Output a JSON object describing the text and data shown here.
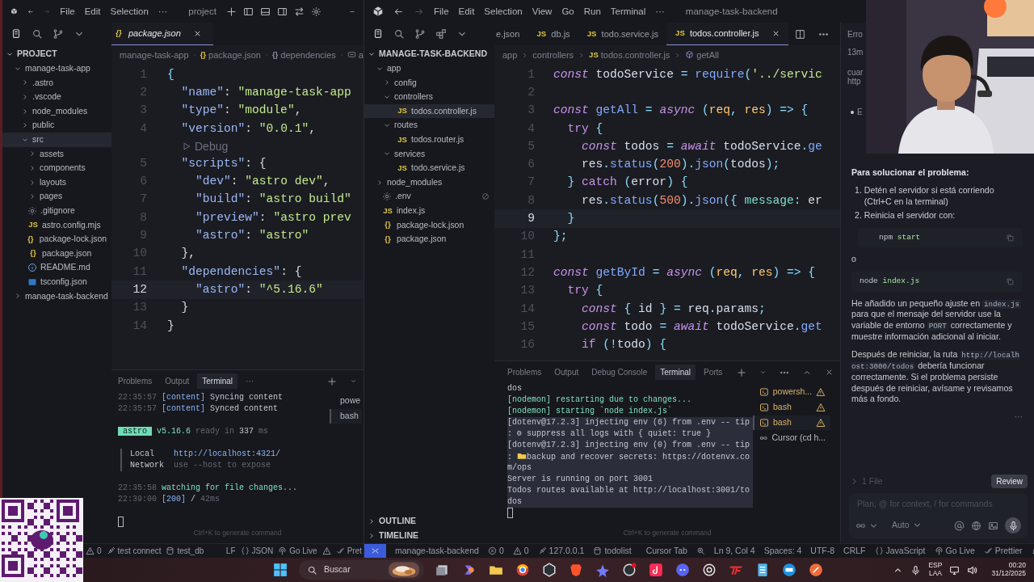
{
  "left_window": {
    "title": "project",
    "menus": [
      "File",
      "Edit",
      "Selection",
      "···"
    ],
    "explorer": {
      "header": "PROJECT",
      "expanded": true,
      "tree": [
        {
          "label": "manage-task-app",
          "kind": "folder",
          "expanded": true,
          "selected": false,
          "children": [
            {
              "label": ".astro",
              "kind": "folder",
              "expanded": false,
              "selected": false
            },
            {
              "label": ".vscode",
              "kind": "folder",
              "expanded": false,
              "selected": false
            },
            {
              "label": "node_modules",
              "kind": "folder",
              "expanded": false,
              "selected": false
            },
            {
              "label": "public",
              "kind": "folder",
              "expanded": false,
              "selected": false
            },
            {
              "label": "src",
              "kind": "folder",
              "expanded": true,
              "selected": true,
              "children": [
                {
                  "label": "assets",
                  "kind": "folder",
                  "expanded": false,
                  "selected": false
                },
                {
                  "label": "components",
                  "kind": "folder",
                  "expanded": false,
                  "selected": false
                },
                {
                  "label": "layouts",
                  "kind": "folder",
                  "expanded": false,
                  "selected": false
                },
                {
                  "label": "pages",
                  "kind": "folder",
                  "expanded": false,
                  "selected": false
                }
              ]
            },
            {
              "label": ".gitignore",
              "kind": "git",
              "selected": false
            },
            {
              "label": "astro.config.mjs",
              "kind": "js",
              "glyph": "JS",
              "selected": false
            },
            {
              "label": "package-lock.json",
              "kind": "json",
              "glyph": "{}",
              "selected": false
            },
            {
              "label": "package.json",
              "kind": "json",
              "glyph": "{}",
              "selected": false
            },
            {
              "label": "README.md",
              "kind": "readme",
              "selected": false
            },
            {
              "label": "tsconfig.json",
              "kind": "ts",
              "selected": false
            }
          ]
        },
        {
          "label": "manage-task-backend",
          "kind": "folder",
          "expanded": false,
          "selected": false
        }
      ]
    },
    "tabs": [
      {
        "glyph": "{}",
        "label": "package.json",
        "selected": true,
        "preview": true
      }
    ],
    "breadcrumb": [
      {
        "kind": "folder",
        "text": "manage-task-app"
      },
      {
        "kind": "file",
        "glyph": "{}",
        "text": "package.json"
      },
      {
        "kind": "symbol",
        "glyph": "{}",
        "text": "dependencies"
      },
      {
        "kind": "field",
        "text": "a"
      }
    ],
    "code": [
      {
        "kind": "code",
        "number": "1",
        "current": false,
        "tokens": [
          {
            "text": "{",
            "kind": "punct"
          }
        ]
      },
      {
        "kind": "code",
        "number": "2",
        "current": false,
        "tokens": [
          {
            "text": "  \"name\"",
            "kind": "key"
          },
          {
            "text": ": ",
            "kind": "plain"
          },
          {
            "text": "\"manage-task-app",
            "kind": "str"
          }
        ]
      },
      {
        "kind": "code",
        "number": "3",
        "current": false,
        "tokens": [
          {
            "text": "  \"type\"",
            "kind": "key"
          },
          {
            "text": ": ",
            "kind": "plain"
          },
          {
            "text": "\"module\"",
            "kind": "str"
          },
          {
            "text": ",",
            "kind": "plain"
          }
        ]
      },
      {
        "kind": "code",
        "number": "4",
        "current": false,
        "tokens": [
          {
            "text": "  \"version\"",
            "kind": "key"
          },
          {
            "text": ": ",
            "kind": "plain"
          },
          {
            "text": "\"0.0.1\"",
            "kind": "str"
          },
          {
            "text": ",",
            "kind": "plain"
          }
        ]
      },
      {
        "kind": "codelens",
        "text": "Debug"
      },
      {
        "kind": "code",
        "number": "5",
        "current": false,
        "tokens": [
          {
            "text": "  \"scripts\"",
            "kind": "key"
          },
          {
            "text": ": {",
            "kind": "plain"
          }
        ]
      },
      {
        "kind": "code",
        "number": "6",
        "current": false,
        "tokens": [
          {
            "text": "    \"dev\"",
            "kind": "key"
          },
          {
            "text": ": ",
            "kind": "plain"
          },
          {
            "text": "\"astro dev\"",
            "kind": "str"
          },
          {
            "text": ",",
            "kind": "plain"
          }
        ]
      },
      {
        "kind": "code",
        "number": "7",
        "current": false,
        "tokens": [
          {
            "text": "    \"build\"",
            "kind": "key"
          },
          {
            "text": ": ",
            "kind": "plain"
          },
          {
            "text": "\"astro build\"",
            "kind": "str"
          }
        ]
      },
      {
        "kind": "code",
        "number": "8",
        "current": false,
        "tokens": [
          {
            "text": "    \"preview\"",
            "kind": "key"
          },
          {
            "text": ": ",
            "kind": "plain"
          },
          {
            "text": "\"astro prev",
            "kind": "str"
          }
        ]
      },
      {
        "kind": "code",
        "number": "9",
        "current": false,
        "tokens": [
          {
            "text": "    \"astro\"",
            "kind": "key"
          },
          {
            "text": ": ",
            "kind": "plain"
          },
          {
            "text": "\"astro\"",
            "kind": "str"
          }
        ]
      },
      {
        "kind": "code",
        "number": "10",
        "current": false,
        "tokens": [
          {
            "text": "  },",
            "kind": "plain"
          }
        ]
      },
      {
        "kind": "code",
        "number": "11",
        "current": false,
        "tokens": [
          {
            "text": "  \"dependencies\"",
            "kind": "key"
          },
          {
            "text": ": {",
            "kind": "plain"
          }
        ]
      },
      {
        "kind": "code",
        "number": "12",
        "current": true,
        "tokens": [
          {
            "text": "    \"astro\"",
            "kind": "key"
          },
          {
            "text": ": ",
            "kind": "plain"
          },
          {
            "text": "\"^5.16.6\"",
            "kind": "str"
          }
        ]
      },
      {
        "kind": "code",
        "number": "13",
        "current": false,
        "tokens": [
          {
            "text": "  }",
            "kind": "plain"
          }
        ]
      },
      {
        "kind": "code",
        "number": "14",
        "current": false,
        "tokens": [
          {
            "text": "}",
            "kind": "plain"
          }
        ]
      }
    ],
    "panel": {
      "tabs": [
        {
          "label": "Problems",
          "selected": false
        },
        {
          "label": "Output",
          "selected": false
        },
        {
          "label": "Terminal",
          "selected": true
        },
        {
          "label": "···",
          "selected": false
        }
      ],
      "blocks": [
        {
          "kind": "plain",
          "lines": [
            [
              {
                "text": "22:35:57 ",
                "kind": "dim"
              },
              {
                "text": "[content]",
                "kind": "blue"
              },
              {
                "text": " Syncing content",
                "kind": "plain"
              }
            ],
            [
              {
                "text": "22:35:57 ",
                "kind": "dim"
              },
              {
                "text": "[content]",
                "kind": "blue"
              },
              {
                "text": " Synced content",
                "kind": "plain"
              }
            ]
          ]
        },
        {
          "kind": "plain",
          "lines": [
            [
              {
                "text": " astro ",
                "kind": "badge"
              },
              {
                "text": " v5.16.6",
                "kind": "green"
              },
              {
                "text": " ready in ",
                "kind": "dim"
              },
              {
                "text": "337",
                "kind": "plain"
              },
              {
                "text": " ms",
                "kind": "dim"
              }
            ]
          ]
        },
        {
          "kind": "quote",
          "lines": [
            [
              {
                "text": "Local    ",
                "kind": "plain"
              },
              {
                "text": "http://localhost:4321/",
                "kind": "blue"
              }
            ],
            [
              {
                "text": "Network  ",
                "kind": "plain"
              },
              {
                "text": "use --host to expose",
                "kind": "dim"
              }
            ]
          ]
        },
        {
          "kind": "plain",
          "lines": [
            [
              {
                "text": "22:35:58 ",
                "kind": "dim"
              },
              {
                "text": "watching for file changes...",
                "kind": "green"
              }
            ],
            [
              {
                "text": "22:39:00 ",
                "kind": "dim"
              },
              {
                "text": "[200]",
                "kind": "blue"
              },
              {
                "text": " / ",
                "kind": "plain"
              },
              {
                "text": "42ms",
                "kind": "dim"
              }
            ]
          ]
        }
      ],
      "terminals": [
        {
          "label": "powe",
          "selected": false,
          "warning": false
        },
        {
          "label": "bash",
          "selected": true,
          "warning": false
        }
      ],
      "hint": "Ctrl+K to generate command"
    },
    "status_bar": {
      "left": [
        {
          "kind": "warning",
          "text": "0"
        },
        {
          "kind": "plug",
          "text": "test connect"
        },
        {
          "kind": "db",
          "text": "test_db"
        }
      ],
      "right": [
        {
          "kind": "plain",
          "text": "LF"
        },
        {
          "kind": "braces",
          "text": "JSON"
        },
        {
          "kind": "live",
          "text": "Go Live"
        },
        {
          "kind": "alert"
        },
        {
          "kind": "check",
          "text": "Pret"
        }
      ]
    }
  },
  "right_window": {
    "title": "manage-task-backend",
    "menus": [
      "File",
      "Edit",
      "Selection",
      "View",
      "Go",
      "Run",
      "Terminal",
      "···"
    ],
    "explorer": {
      "header": "MANAGE-TASK-BACKEND",
      "expanded": true,
      "tree": [
        {
          "label": "app",
          "kind": "folder",
          "expanded": true,
          "selected": false,
          "excluded": false,
          "children": [
            {
              "label": "config",
              "kind": "folder",
              "expanded": false,
              "selected": false
            },
            {
              "label": "controllers",
              "kind": "folder",
              "expanded": true,
              "selected": false,
              "children": [
                {
                  "label": "todos.controller.js",
                  "kind": "js",
                  "glyph": "JS",
                  "selected": true
                }
              ]
            },
            {
              "label": "routes",
              "kind": "folder",
              "expanded": true,
              "selected": false,
              "children": [
                {
                  "label": "todos.router.js",
                  "kind": "js",
                  "glyph": "JS",
                  "selected": false
                }
              ]
            },
            {
              "label": "services",
              "kind": "folder",
              "expanded": true,
              "selected": false,
              "children": [
                {
                  "label": "todo.service.js",
                  "kind": "js",
                  "glyph": "JS",
                  "selected": false
                }
              ]
            }
          ]
        },
        {
          "label": "node_modules",
          "kind": "folder",
          "expanded": false,
          "selected": false,
          "excluded": false
        },
        {
          "label": ".env",
          "kind": "env",
          "selected": false,
          "excluded": true
        },
        {
          "label": "index.js",
          "kind": "js",
          "glyph": "JS",
          "selected": false,
          "excluded": false
        },
        {
          "label": "package-lock.json",
          "kind": "json",
          "glyph": "{}",
          "selected": false,
          "excluded": false
        },
        {
          "label": "package.json",
          "kind": "json",
          "glyph": "{}",
          "selected": false,
          "excluded": false
        }
      ],
      "sections": [
        {
          "label": "OUTLINE",
          "expanded": false
        },
        {
          "label": "TIMELINE",
          "expanded": false
        }
      ]
    },
    "tabs": [
      {
        "label": "e.json",
        "selected": false,
        "preview": false
      },
      {
        "glyph": "JS",
        "label": "db.js",
        "selected": false,
        "preview": false
      },
      {
        "glyph": "JS",
        "label": "todo.service.js",
        "selected": false,
        "preview": false
      },
      {
        "glyph": "JS",
        "label": "todos.controller.js",
        "selected": true,
        "preview": false
      }
    ],
    "breadcrumb": [
      {
        "kind": "folder",
        "text": "app"
      },
      {
        "kind": "folder",
        "text": "controllers"
      },
      {
        "kind": "file",
        "glyph": "JS",
        "text": "todos.controller.js"
      },
      {
        "kind": "function",
        "text": "getAll"
      }
    ],
    "code": [
      {
        "kind": "code",
        "number": "1",
        "current": false,
        "tokens": [
          {
            "text": "const",
            "kind": "kw"
          },
          {
            "text": " todoService ",
            "kind": "id"
          },
          {
            "text": "= ",
            "kind": "punct"
          },
          {
            "text": "require",
            "kind": "fn"
          },
          {
            "text": "(",
            "kind": "punct"
          },
          {
            "text": "'../servic",
            "kind": "str"
          }
        ]
      },
      {
        "kind": "code",
        "number": "2",
        "current": false
      },
      {
        "kind": "code",
        "number": "3",
        "current": false,
        "tokens": [
          {
            "text": "const",
            "kind": "kw"
          },
          {
            "text": " getAll ",
            "kind": "fn"
          },
          {
            "text": "= ",
            "kind": "punct"
          },
          {
            "text": "async",
            "kind": "kw"
          },
          {
            "text": " (",
            "kind": "punct"
          },
          {
            "text": "req",
            "kind": "param"
          },
          {
            "text": ", ",
            "kind": "punct"
          },
          {
            "text": "res",
            "kind": "param"
          },
          {
            "text": ") => {",
            "kind": "punct"
          }
        ]
      },
      {
        "kind": "code",
        "number": "4",
        "current": false,
        "tokens": [
          {
            "text": "  try",
            "kind": "ctrl"
          },
          {
            "text": " {",
            "kind": "punct"
          }
        ]
      },
      {
        "kind": "code",
        "number": "5",
        "current": false,
        "tokens": [
          {
            "text": "    const",
            "kind": "kw"
          },
          {
            "text": " todos ",
            "kind": "id"
          },
          {
            "text": "= ",
            "kind": "punct"
          },
          {
            "text": "await",
            "kind": "kw"
          },
          {
            "text": " todoService",
            "kind": "id"
          },
          {
            "text": ".",
            "kind": "punct"
          },
          {
            "text": "ge",
            "kind": "fn"
          }
        ]
      },
      {
        "kind": "code",
        "number": "6",
        "current": false,
        "tokens": [
          {
            "text": "    res",
            "kind": "id"
          },
          {
            "text": ".",
            "kind": "punct"
          },
          {
            "text": "status",
            "kind": "fn"
          },
          {
            "text": "(",
            "kind": "punct"
          },
          {
            "text": "200",
            "kind": "num"
          },
          {
            "text": ").",
            "kind": "punct"
          },
          {
            "text": "json",
            "kind": "fn"
          },
          {
            "text": "(",
            "kind": "punct"
          },
          {
            "text": "todos",
            "kind": "id"
          },
          {
            "text": ");",
            "kind": "punct"
          }
        ]
      },
      {
        "kind": "code",
        "number": "7",
        "current": false,
        "tokens": [
          {
            "text": "  }",
            "kind": "punct"
          },
          {
            "text": " catch",
            "kind": "ctrl"
          },
          {
            "text": " (",
            "kind": "punct"
          },
          {
            "text": "error",
            "kind": "id"
          },
          {
            "text": ") {",
            "kind": "punct"
          }
        ]
      },
      {
        "kind": "code",
        "number": "8",
        "current": false,
        "tokens": [
          {
            "text": "    res",
            "kind": "id"
          },
          {
            "text": ".",
            "kind": "punct"
          },
          {
            "text": "status",
            "kind": "fn"
          },
          {
            "text": "(",
            "kind": "punct"
          },
          {
            "text": "500",
            "kind": "num"
          },
          {
            "text": ").",
            "kind": "punct"
          },
          {
            "text": "json",
            "kind": "fn"
          },
          {
            "text": "({",
            "kind": "punct"
          },
          {
            "text": " message",
            "kind": "prop"
          },
          {
            "text": ": ",
            "kind": "punct"
          },
          {
            "text": "er",
            "kind": "id"
          }
        ]
      },
      {
        "kind": "code",
        "number": "9",
        "current": true,
        "tokens": [
          {
            "text": "  }",
            "kind": "punct"
          }
        ]
      },
      {
        "kind": "code",
        "number": "10",
        "current": false,
        "tokens": [
          {
            "text": "};",
            "kind": "punct"
          }
        ]
      },
      {
        "kind": "code",
        "number": "11",
        "current": false
      },
      {
        "kind": "code",
        "number": "12",
        "current": false,
        "tokens": [
          {
            "text": "const",
            "kind": "kw"
          },
          {
            "text": " getById ",
            "kind": "fn"
          },
          {
            "text": "= ",
            "kind": "punct"
          },
          {
            "text": "async",
            "kind": "kw"
          },
          {
            "text": " (",
            "kind": "punct"
          },
          {
            "text": "req",
            "kind": "param"
          },
          {
            "text": ", ",
            "kind": "punct"
          },
          {
            "text": "res",
            "kind": "param"
          },
          {
            "text": ") => {",
            "kind": "punct"
          }
        ]
      },
      {
        "kind": "code",
        "number": "13",
        "current": false,
        "tokens": [
          {
            "text": "  try",
            "kind": "ctrl"
          },
          {
            "text": " {",
            "kind": "punct"
          }
        ]
      },
      {
        "kind": "code",
        "number": "14",
        "current": false,
        "tokens": [
          {
            "text": "    const",
            "kind": "kw"
          },
          {
            "text": " { ",
            "kind": "punct"
          },
          {
            "text": "id",
            "kind": "id"
          },
          {
            "text": " } ",
            "kind": "punct"
          },
          {
            "text": "=",
            "kind": "punct"
          },
          {
            "text": " req",
            "kind": "id"
          },
          {
            "text": ".",
            "kind": "punct"
          },
          {
            "text": "params",
            "kind": "id"
          },
          {
            "text": ";",
            "kind": "punct"
          }
        ]
      },
      {
        "kind": "code",
        "number": "15",
        "current": false,
        "tokens": [
          {
            "text": "    const",
            "kind": "kw"
          },
          {
            "text": " todo ",
            "kind": "id"
          },
          {
            "text": "= ",
            "kind": "punct"
          },
          {
            "text": "await",
            "kind": "kw"
          },
          {
            "text": " todoService",
            "kind": "id"
          },
          {
            "text": ".",
            "kind": "punct"
          },
          {
            "text": "get",
            "kind": "fn"
          }
        ]
      },
      {
        "kind": "code",
        "number": "16",
        "current": false,
        "tokens": [
          {
            "text": "    if",
            "kind": "ctrl"
          },
          {
            "text": " (!",
            "kind": "punct"
          },
          {
            "text": "todo",
            "kind": "id"
          },
          {
            "text": ") {",
            "kind": "punct"
          }
        ]
      }
    ],
    "panel": {
      "tabs": [
        {
          "label": "Problems",
          "selected": false
        },
        {
          "label": "Output",
          "selected": false
        },
        {
          "label": "Debug Console",
          "selected": false
        },
        {
          "label": "Terminal",
          "selected": true
        },
        {
          "label": "Ports",
          "selected": false
        }
      ],
      "lines": [
        {
          "selected": false,
          "segments": [
            {
              "text": "dos",
              "kind": "plain"
            }
          ]
        },
        {
          "selected": false,
          "segments": [
            {
              "text": "[nodemon] restarting due to changes...",
              "kind": "green"
            }
          ]
        },
        {
          "selected": false,
          "segments": [
            {
              "text": "[nodemon] starting `node index.js`",
              "kind": "green"
            }
          ]
        },
        {
          "selected": true,
          "segments": [
            {
              "text": "[dotenv@17.2.3] injecting env (6) from .env -- tip",
              "kind": "plain"
            }
          ]
        },
        {
          "selected": true,
          "segments": [
            {
              "text": ": ⚙ suppress all logs with { quiet: true }",
              "kind": "plain"
            }
          ]
        },
        {
          "selected": true,
          "segments": [
            {
              "text": "[dotenv@17.2.3] injecting env (0) from .env -- tip",
              "kind": "plain"
            }
          ]
        },
        {
          "selected": true,
          "segments": [
            {
              "text": ": ",
              "kind": "plain"
            },
            {
              "text": "backup and recover secrets: https://dotenvx.co",
              "kind": "folder"
            }
          ]
        },
        {
          "selected": true,
          "segments": [
            {
              "text": "m/ops",
              "kind": "plain"
            }
          ]
        },
        {
          "selected": true,
          "segments": [
            {
              "text": "Server is running on port 3001",
              "kind": "plain"
            }
          ]
        },
        {
          "selected": true,
          "segments": [
            {
              "text": "Todos routes available at http://localhost:3001/to",
              "kind": "plain"
            }
          ]
        },
        {
          "selected": true,
          "segments": [
            {
              "text": "dos",
              "kind": "plain"
            }
          ]
        }
      ],
      "terminals": [
        {
          "label": "powersh...",
          "kind": "shell",
          "selected": false,
          "warning": true
        },
        {
          "label": "bash",
          "kind": "shell",
          "selected": false,
          "warning": true
        },
        {
          "label": "bash",
          "kind": "shell",
          "selected": true,
          "warning": true
        },
        {
          "label": "Cursor (cd h...",
          "kind": "agent",
          "selected": false,
          "warning": false
        }
      ],
      "hint": "Ctrl+K to generate command"
    },
    "chat": {
      "tab": "Erro",
      "time": "13m",
      "snippet": [
        "cuar",
        "http"
      ],
      "bullet_fragment": "E",
      "blocks": [
        {
          "kind": "heading",
          "text": "Para solucionar el problema:"
        },
        {
          "kind": "steps",
          "items": [
            {
              "number": "1.",
              "text": "Detén el servidor si está corriendo (Ctrl+C en la terminal)"
            },
            {
              "number": "2.",
              "text": "Reinicia el servidor con:"
            }
          ]
        },
        {
          "kind": "code",
          "indent": true,
          "tokens": [
            {
              "text": "npm",
              "kind": "plain"
            },
            {
              "text": " start",
              "kind": "green"
            }
          ]
        },
        {
          "kind": "text",
          "text": "o"
        },
        {
          "kind": "code",
          "indent": false,
          "tokens": [
            {
              "text": "node",
              "kind": "plain"
            },
            {
              "text": " index.js",
              "kind": "green"
            }
          ]
        },
        {
          "kind": "paragraph",
          "segments": [
            {
              "text": "He añadido un pequeño ajuste en ",
              "kind": "text"
            },
            {
              "text": "index.js",
              "kind": "code"
            },
            {
              "text": " para que el mensaje del servidor use la variable de entorno ",
              "kind": "text"
            },
            {
              "text": "PORT",
              "kind": "code"
            },
            {
              "text": " correctamente y muestre información adicional al iniciar.",
              "kind": "text"
            }
          ]
        },
        {
          "kind": "paragraph",
          "segments": [
            {
              "text": "Después de reiniciar, la ruta ",
              "kind": "text"
            },
            {
              "text": "http://localhost:3000/todos",
              "kind": "code"
            },
            {
              "text": " debería funcionar correctamente. Si el problema persiste después de reiniciar, avísame y revisamos más a fondo.",
              "kind": "text"
            }
          ]
        }
      ],
      "more": "···",
      "files": "1 File",
      "review": "Review",
      "input": {
        "placeholder": "Plan, @ for context, / for commands"
      },
      "mode": "Auto"
    },
    "status_bar": {
      "left": [
        {
          "kind": "remote"
        },
        {
          "kind": "plain",
          "text": "manage-task-backend"
        },
        {
          "kind": "error",
          "text": "0"
        },
        {
          "kind": "warning",
          "text": "0"
        },
        {
          "kind": "plug",
          "text": "127.0.0.1"
        },
        {
          "kind": "db",
          "text": "todolist"
        }
      ],
      "right": [
        {
          "kind": "plain",
          "text": "Cursor Tab"
        },
        {
          "kind": "zoom"
        },
        {
          "kind": "plain",
          "text": "Ln 9, Col 4"
        },
        {
          "kind": "plain",
          "text": "Spaces: 4"
        },
        {
          "kind": "plain",
          "text": "UTF-8"
        },
        {
          "kind": "plain",
          "text": "CRLF"
        },
        {
          "kind": "braces",
          "text": "JavaScript"
        },
        {
          "kind": "live",
          "text": "Go Live"
        },
        {
          "kind": "check",
          "text": "Prettier"
        },
        {
          "kind": "bell"
        }
      ]
    }
  },
  "taskbar": {
    "search": {
      "placeholder": "Buscar"
    },
    "language": [
      "ESP",
      "LAA"
    ],
    "time": "00:20",
    "date": "31/12/2025"
  }
}
